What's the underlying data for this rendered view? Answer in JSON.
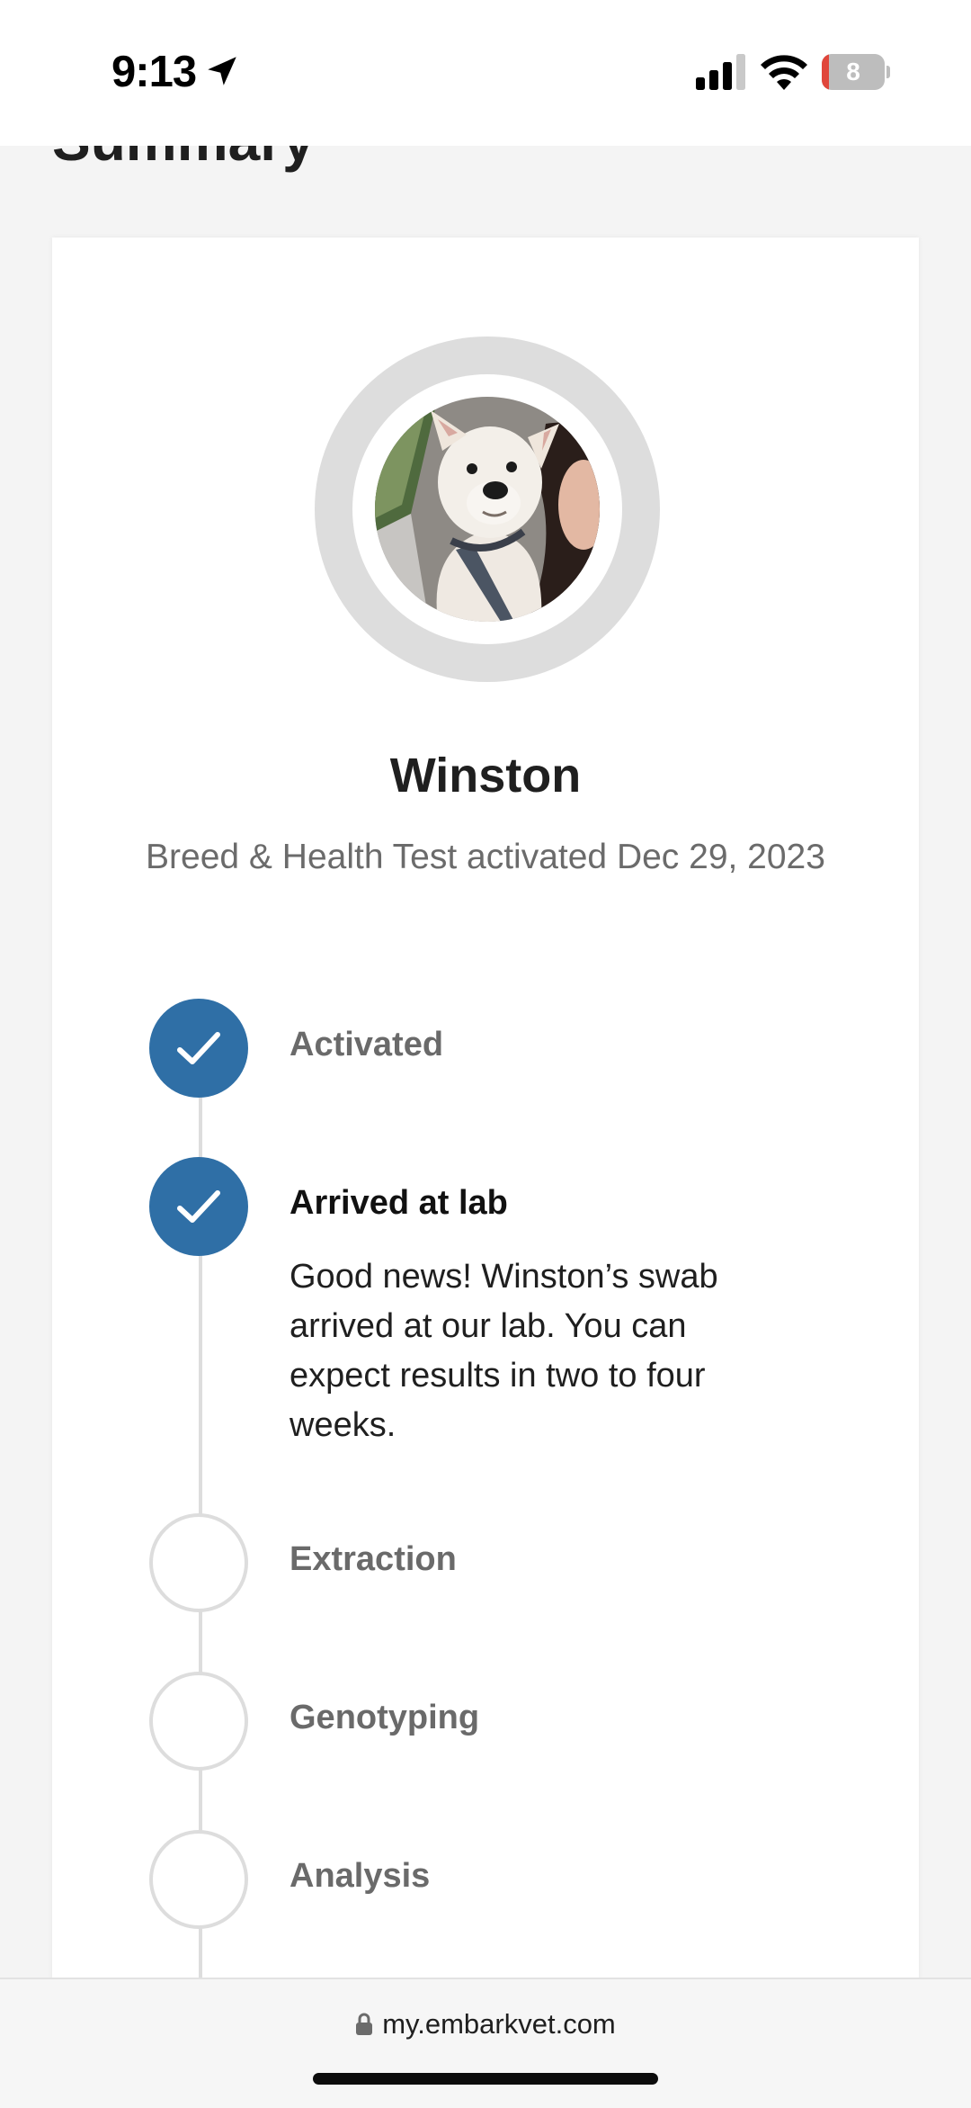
{
  "status_bar": {
    "time": "9:13",
    "battery_level": "8",
    "battery_fraction": 0.08,
    "icons": [
      "location-arrow-icon",
      "cellular-signal-icon",
      "wifi-icon",
      "battery-icon"
    ]
  },
  "page": {
    "title": "Summary"
  },
  "pet": {
    "name": "Winston",
    "activation_text": "Breed & Health Test activated Dec 29, 2023"
  },
  "timeline": {
    "steps": [
      {
        "label": "Activated",
        "status": "done"
      },
      {
        "label": "Arrived at lab",
        "status": "current",
        "description": "Good news! Winston’s swab arrived at our lab. You can expect results in two to four weeks."
      },
      {
        "label": "Extraction",
        "status": "pending"
      },
      {
        "label": "Genotyping",
        "status": "pending"
      },
      {
        "label": "Analysis",
        "status": "pending"
      }
    ]
  },
  "browser": {
    "url": "my.embarkvet.com"
  },
  "colors": {
    "accent": "#2f6fa6",
    "ring": "#dddddd",
    "battery_low": "#e0463b"
  }
}
